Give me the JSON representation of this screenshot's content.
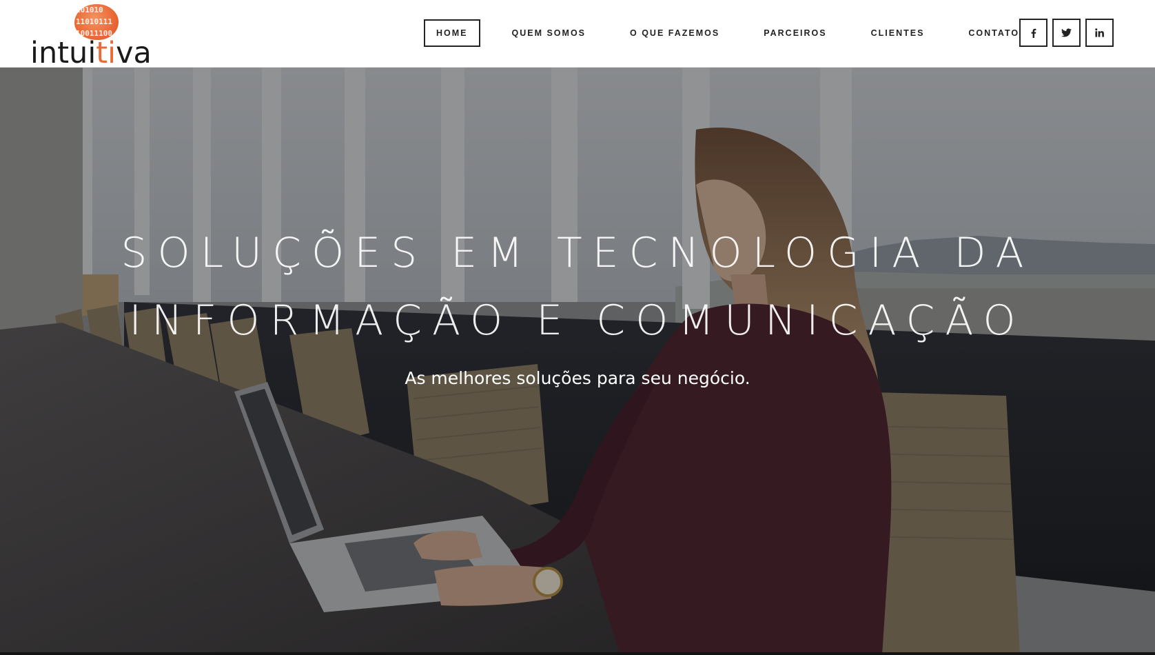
{
  "brand": {
    "logo_prefix": "intui",
    "logo_accent": "ti",
    "logo_suffix": "va",
    "logo_binary": "101010\n11010111\n10011100",
    "accent_color": "#ea6a36"
  },
  "nav": {
    "items": [
      {
        "label": "HOME",
        "active": true
      },
      {
        "label": "QUEM SOMOS"
      },
      {
        "label": "O QUE FAZEMOS"
      },
      {
        "label": "PARCEIROS"
      },
      {
        "label": "CLIENTES"
      },
      {
        "label": "CONTATO"
      }
    ]
  },
  "social": {
    "icons": [
      "facebook-icon",
      "twitter-icon",
      "linkedin-icon"
    ]
  },
  "hero": {
    "title_line1": "SOLUÇÕES EM TECNOLOGIA DA",
    "title_line2": "INFORMAÇÃO E COMUNICAÇÃO",
    "subtitle": "As melhores soluções para seu negócio."
  }
}
